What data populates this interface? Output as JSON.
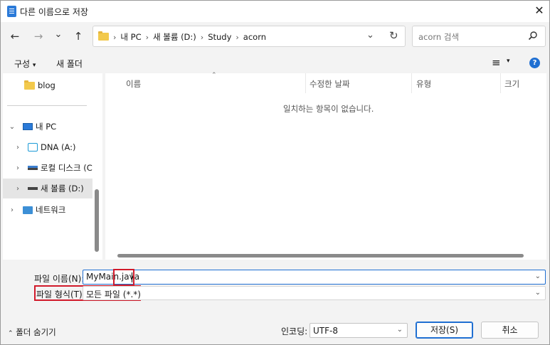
{
  "window": {
    "title": "다른 이름으로 저장"
  },
  "nav": {
    "back": "←",
    "forward": "→",
    "recent": "⌄",
    "up": "↑",
    "breadcrumbs": [
      "내 PC",
      "새 볼륨 (D:)",
      "Study",
      "acorn"
    ],
    "refresh": "↻",
    "history": "⌄"
  },
  "search": {
    "placeholder": "acorn 검색"
  },
  "toolbar": {
    "organize": "구성",
    "new_folder": "새 폴더",
    "view": "≡"
  },
  "sidebar": {
    "items": [
      {
        "label": "blog"
      },
      {
        "label": "내 PC"
      },
      {
        "label": "DNA (A:)"
      },
      {
        "label": "로컬 디스크 (C"
      },
      {
        "label": "새 볼륨 (D:)"
      },
      {
        "label": "네트워크"
      }
    ]
  },
  "columns": [
    "이름",
    "수정한 날짜",
    "유형",
    "크기"
  ],
  "empty_message": "일치하는 항목이 없습니다.",
  "form": {
    "filename_label": "파일 이름(N):",
    "filename_value": "MyMain.java",
    "filetype_label": "파일 형식(T):",
    "filetype_value": "모든 파일  (*.*)"
  },
  "footer": {
    "hide_folders": "폴더 숨기기",
    "encoding_label": "인코딩:",
    "encoding_value": "UTF-8",
    "save": "저장(S)",
    "cancel": "취소"
  },
  "colors": {
    "accent": "#1f6fd2",
    "highlight": "#d11a2a"
  }
}
